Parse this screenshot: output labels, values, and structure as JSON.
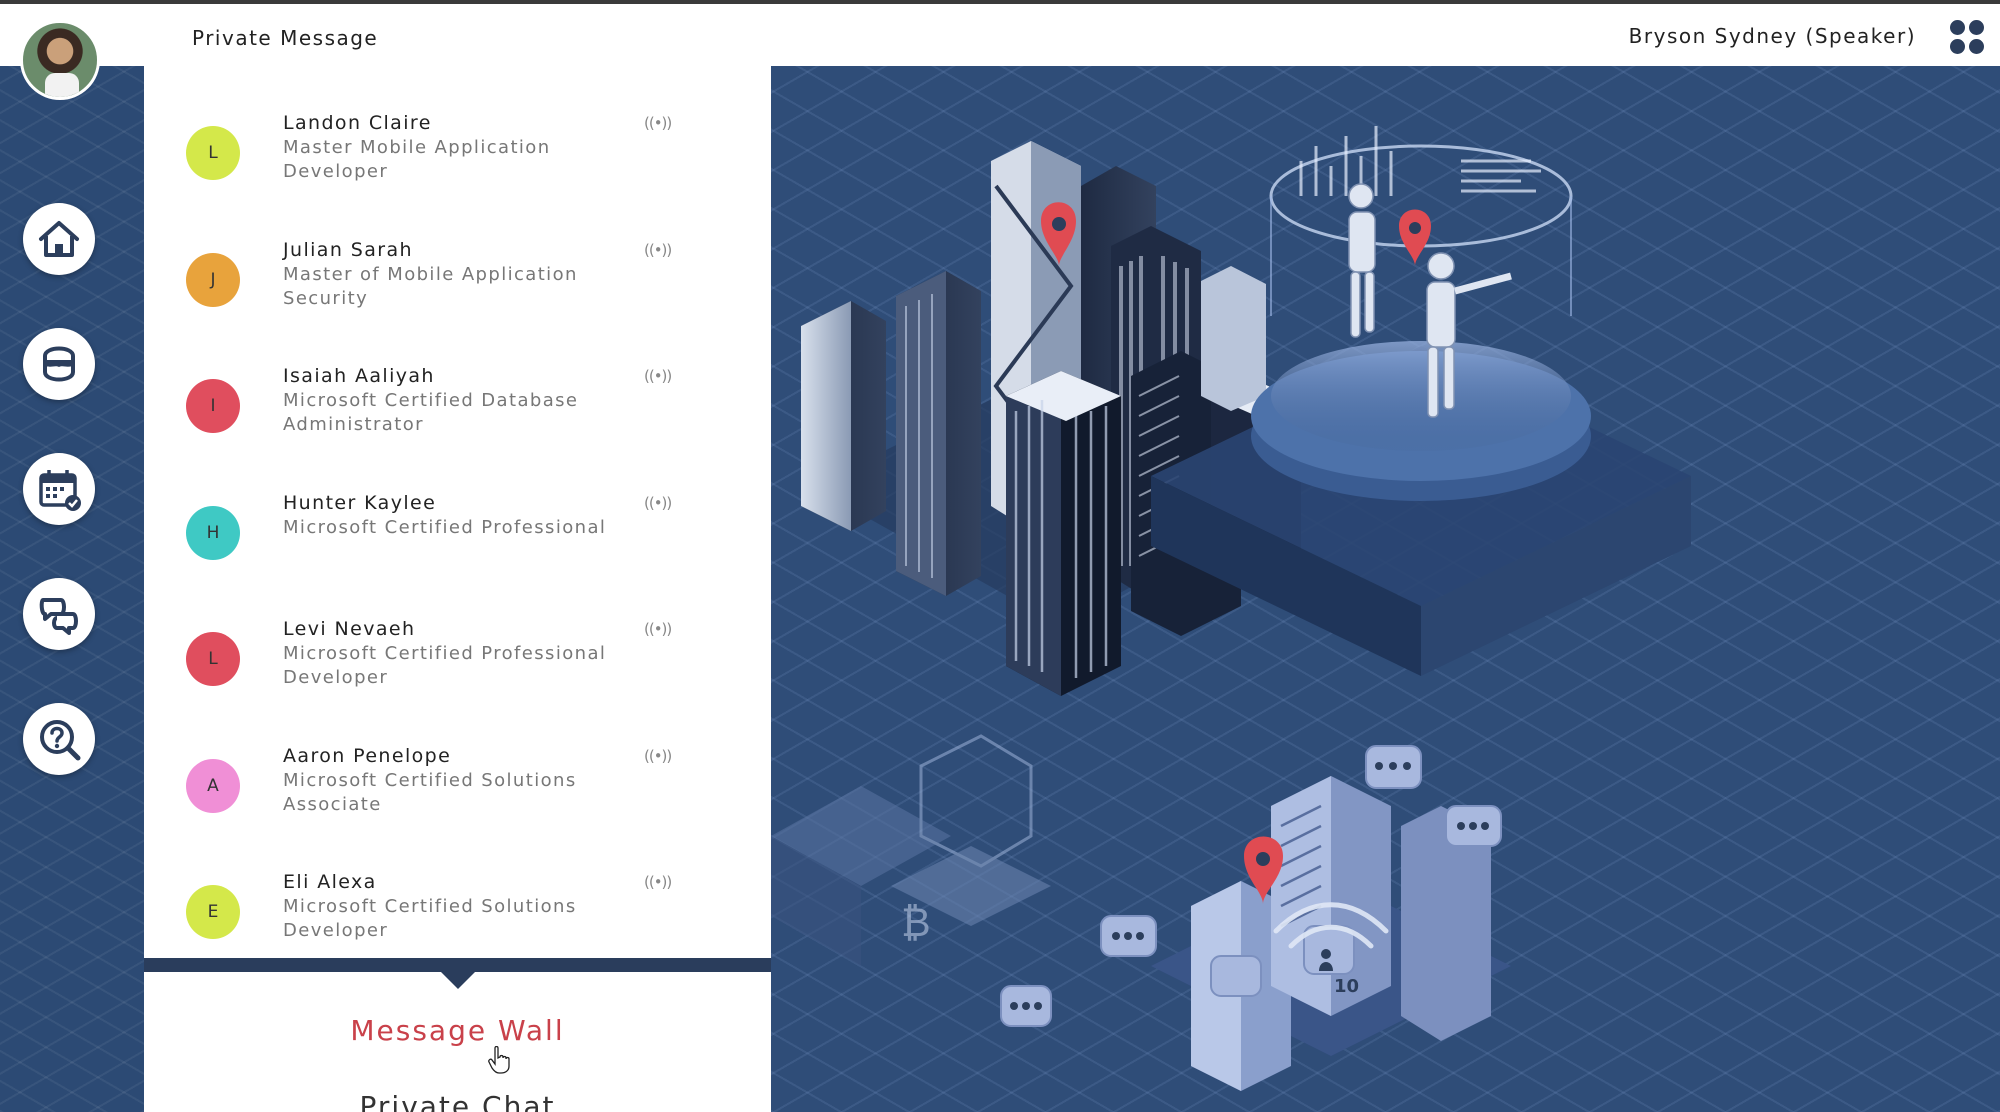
{
  "header": {
    "title": "Private Message",
    "user": "Bryson Sydney (Speaker)"
  },
  "sidebar": {
    "items": [
      {
        "name": "home",
        "icon": "home-icon"
      },
      {
        "name": "profile",
        "icon": "mask-face-icon"
      },
      {
        "name": "calendar",
        "icon": "calendar-check-icon"
      },
      {
        "name": "chat",
        "icon": "chat-bubbles-icon"
      },
      {
        "name": "help",
        "icon": "question-search-icon"
      }
    ]
  },
  "contacts": [
    {
      "initial": "L",
      "name": "Landon Claire",
      "role": "Master Mobile Application Developer",
      "color": "#d4e84a"
    },
    {
      "initial": "J",
      "name": "Julian Sarah",
      "role": "Master of Mobile Application Security",
      "color": "#e8a33c"
    },
    {
      "initial": "I",
      "name": "Isaiah Aaliyah",
      "role": "Microsoft Certified Database Administrator",
      "color": "#e04e5e"
    },
    {
      "initial": "H",
      "name": "Hunter Kaylee",
      "role": "Microsoft Certified Professional",
      "color": "#3fc9c4"
    },
    {
      "initial": "L",
      "name": "Levi Nevaeh",
      "role": "Microsoft Certified Professional Developer",
      "color": "#e04e5e"
    },
    {
      "initial": "A",
      "name": "Aaron Penelope",
      "role": "Microsoft Certified Solutions Associate",
      "color": "#f08fd6"
    },
    {
      "initial": "E",
      "name": "Eli Alexa",
      "role": "Microsoft Certified Solutions Developer",
      "color": "#d4e84a"
    }
  ],
  "contact_action_glyph": "((•))",
  "tabs": {
    "message_wall": "Message Wall",
    "private_chat": "Private Chat"
  },
  "colors": {
    "accent_red": "#c9414a",
    "sidebar_bg": "#2c4a74",
    "scene_bg": "#2f4d78"
  },
  "scene_badge": "10"
}
